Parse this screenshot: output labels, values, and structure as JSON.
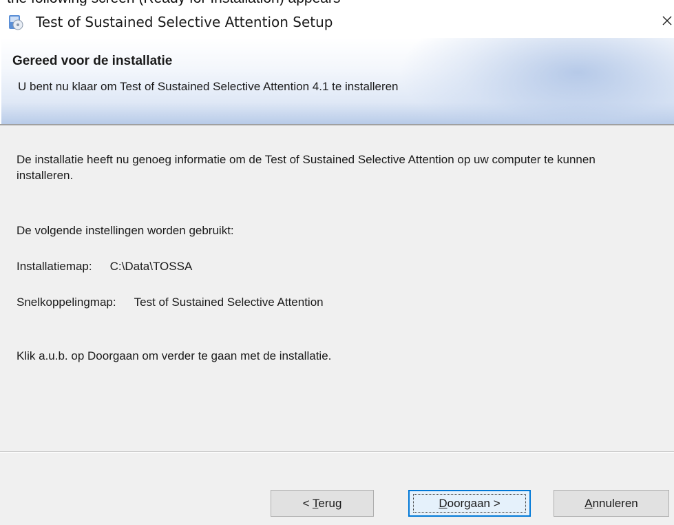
{
  "document_fragment": "the following screen (Ready for Installation) appears",
  "window": {
    "title": "Test of Sustained Selective Attention Setup",
    "close_glyph": "×"
  },
  "header": {
    "title": "Gereed voor de installatie",
    "subtitle": "U bent nu klaar om Test of Sustained Selective Attention 4.1 te installeren"
  },
  "body": {
    "info_text": "De installatie heeft nu genoeg informatie om de Test of Sustained Selective Attention op uw computer te kunnen installeren.",
    "settings_intro": "De volgende instellingen worden gebruikt:",
    "install_dir_label": "Installatiemap:",
    "install_dir_value": "C:\\Data\\TOSSA",
    "shortcut_label": "Snelkoppelingmap:",
    "shortcut_value": "Test of Sustained Selective Attention",
    "continue_text": "Klik a.u.b. op Doorgaan om verder te gaan met de installatie."
  },
  "buttons": {
    "back": {
      "prefix": "< ",
      "mnemonic": "T",
      "rest": "erug"
    },
    "next": {
      "prefix": "",
      "mnemonic": "D",
      "rest": "oorgaan >"
    },
    "cancel": {
      "prefix": "",
      "mnemonic": "A",
      "rest": "nnuleren"
    }
  },
  "colors": {
    "accent_focus": "#0078d7",
    "banner_blue": "#b8cbe8",
    "dialog_bg": "#f0f0f0"
  },
  "icons": {
    "app": "installer-disk-icon",
    "close": "close-icon"
  }
}
